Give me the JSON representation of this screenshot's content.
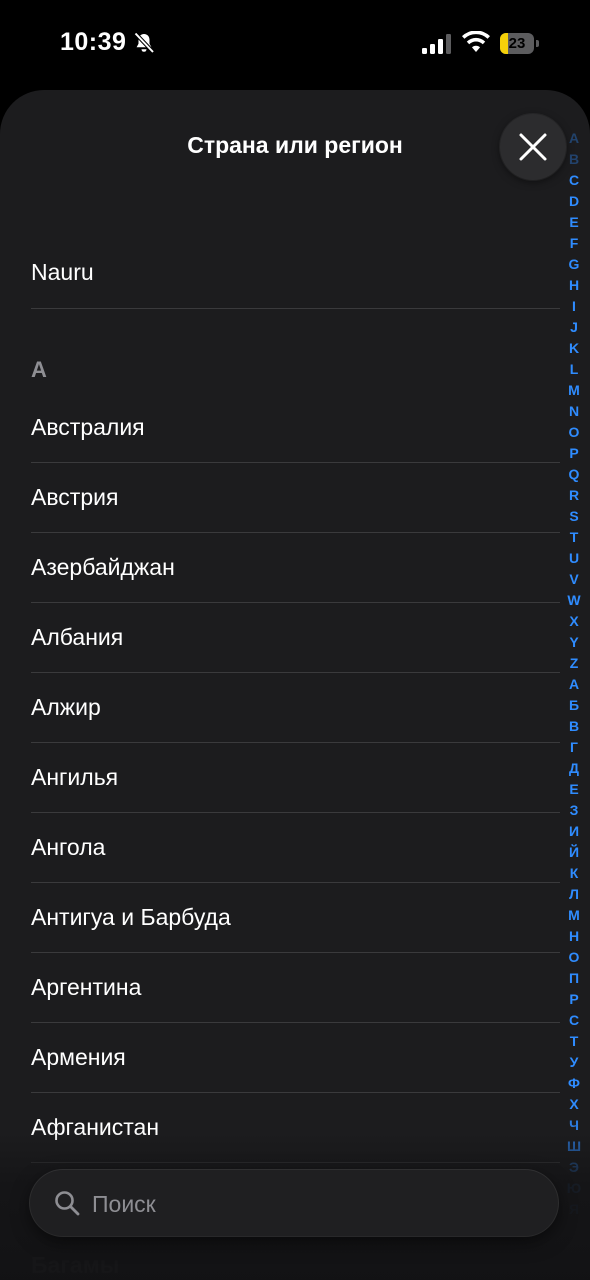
{
  "status_bar": {
    "time": "10:39",
    "battery_level": "23",
    "battery_fraction": 0.23
  },
  "sheet": {
    "title": "Страна или регион"
  },
  "list": {
    "top_item": "Nauru",
    "section_header": "А",
    "items": [
      "Австралия",
      "Австрия",
      "Азербайджан",
      "Албания",
      "Алжир",
      "Ангилья",
      "Ангола",
      "Антигуа и Барбуда",
      "Аргентина",
      "Армения",
      "Афганистан"
    ],
    "ghost_item": "Багамы"
  },
  "index_letters": [
    "A",
    "B",
    "C",
    "D",
    "E",
    "F",
    "G",
    "H",
    "I",
    "J",
    "K",
    "L",
    "M",
    "N",
    "O",
    "P",
    "Q",
    "R",
    "S",
    "T",
    "U",
    "V",
    "W",
    "X",
    "Y",
    "Z",
    "А",
    "Б",
    "В",
    "Г",
    "Д",
    "Е",
    "З",
    "И",
    "Й",
    "К",
    "Л",
    "М",
    "Н",
    "О",
    "П",
    "Р",
    "С",
    "Т",
    "У",
    "Ф",
    "Х",
    "Ч",
    "Ш",
    "Э",
    "Ю",
    "Я"
  ],
  "search": {
    "placeholder": "Поиск",
    "value": ""
  },
  "colors": {
    "background": "#000000",
    "sheet": "#1c1c1e",
    "accent": "#2f8cff",
    "separator": "#3a3a3c",
    "secondary_text": "#8e8e93",
    "battery_fill": "#f5d10a"
  },
  "icons": {
    "bell": "bell-slash-icon",
    "signal": "cellular-signal-icon",
    "wifi": "wifi-icon",
    "close": "close-icon",
    "search": "search-icon"
  }
}
